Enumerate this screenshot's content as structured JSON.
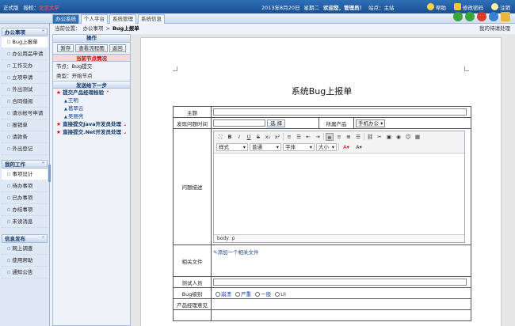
{
  "topbar": {
    "version": "正式版",
    "license": "授权：",
    "license_value": "北京大学",
    "date": "2013年8月20日",
    "weekday": "星期二",
    "welcome": "欢迎您，管理员！",
    "site_label": "站点：",
    "site_value": "主站",
    "help": "帮助",
    "change_password": "修改密码",
    "logout": "注销"
  },
  "tabs": [
    "办公系统",
    "个人平台",
    "系统管理",
    "系统信息"
  ],
  "breadcrumb": {
    "prefix": "当前位置：",
    "parent": "办公事项",
    "current": "Bug上报单",
    "right": "我的待请处理"
  },
  "sidebar": {
    "office": {
      "title": "办公事项",
      "items": [
        "Bug上报单",
        "办公用品申请",
        "工作交办",
        "立项申请",
        "外出测试",
        "合同借阅",
        "请示帐号申请",
        "报销单",
        "请款条",
        "外出登记"
      ]
    },
    "work": {
      "title": "我的工作",
      "items": [
        "事项设计",
        "待办事项",
        "已办事项",
        "办结事项",
        "未读消息"
      ]
    },
    "info": {
      "title": "信息发布",
      "items": [
        "网上调查",
        "使用帮助",
        "通知公告"
      ]
    }
  },
  "workflow": {
    "title": "操作",
    "buttons": [
      "暂存",
      "查看流程图",
      "返回"
    ],
    "node_title": "当前节点情况",
    "node_label": "节点：",
    "node_value": "Bug提交",
    "type_label": "类型：",
    "type_value": "开始节点",
    "next_title": "发送给下一步",
    "steps": [
      {
        "name": "提交产品经理检验",
        "people": [
          "王明",
          "葛翠云",
          "吴丽亮"
        ]
      },
      {
        "name": "直接提交Java开发员处理",
        "people": []
      },
      {
        "name": "直接提交.Net开发员处理",
        "people": []
      }
    ]
  },
  "form": {
    "title": "系统Bug上报单",
    "rows": {
      "subject": "主题",
      "found_time": "发现问题时间",
      "select_btn": "选 择",
      "product_label": "所属产品",
      "product_value": "手机办公",
      "description": "问题描述",
      "attachment": "相关文件",
      "add_attachment": "添加一个相关文件",
      "tester": "测试人员",
      "level": "Bug级别",
      "level_options": [
        "崩溃",
        "严重",
        "一般",
        "UI"
      ],
      "pm_opinion": "产品经理意见"
    },
    "editor": {
      "style": "样式",
      "format": "普通",
      "font": "字体",
      "size": "大小",
      "status_body": "body",
      "status_p": "p"
    }
  }
}
